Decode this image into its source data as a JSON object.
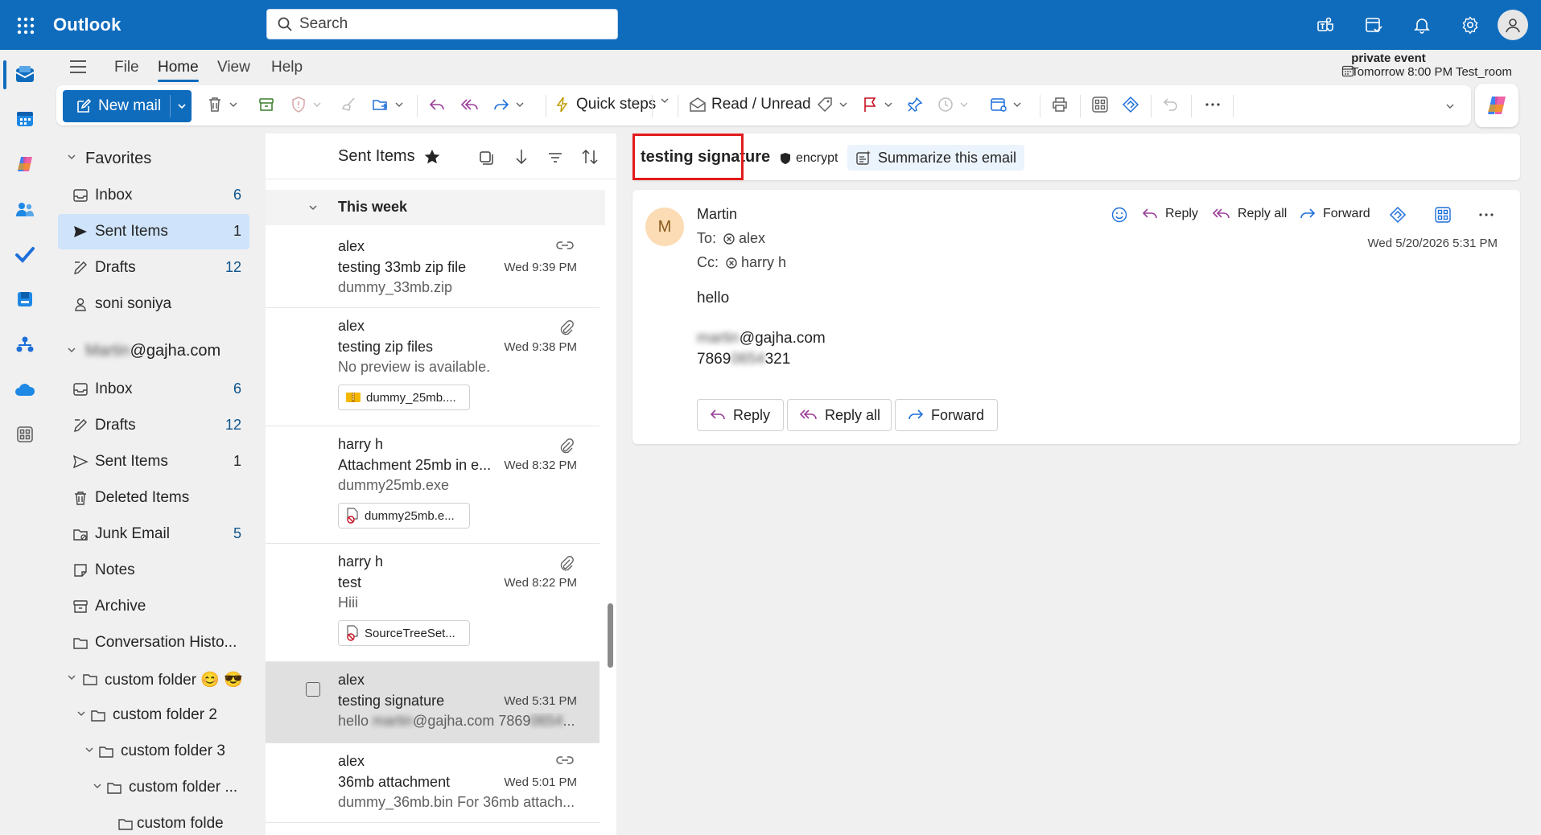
{
  "app": {
    "title": "Outlook"
  },
  "search": {
    "placeholder": "Search"
  },
  "menu": {
    "file": "File",
    "home": "Home",
    "view": "View",
    "help": "Help"
  },
  "event": {
    "title": "private event",
    "detail": "Tomorrow 8:00 PM Test_room"
  },
  "ribbon": {
    "new_mail": "New mail",
    "quick_steps": "Quick steps",
    "read_unread": "Read / Unread"
  },
  "folders": {
    "favorites_header": "Favorites",
    "favorites": [
      {
        "label": "Inbox",
        "count": "6"
      },
      {
        "label": "Sent Items",
        "count": "1"
      },
      {
        "label": "Drafts",
        "count": "12"
      },
      {
        "label": "soni soniya",
        "count": ""
      }
    ],
    "account_blurred": "Martin",
    "account_domain": "@gajha.com",
    "account": [
      {
        "label": "Inbox",
        "count": "6"
      },
      {
        "label": "Drafts",
        "count": "12"
      },
      {
        "label": "Sent Items",
        "count": "1"
      },
      {
        "label": "Deleted Items",
        "count": ""
      },
      {
        "label": "Junk Email",
        "count": "5"
      },
      {
        "label": "Notes",
        "count": ""
      },
      {
        "label": "Archive",
        "count": ""
      },
      {
        "label": "Conversation Histo...",
        "count": ""
      },
      {
        "label": "custom folder 😊 😎",
        "count": ""
      },
      {
        "label": "custom folder 2",
        "count": ""
      },
      {
        "label": "custom folder 3",
        "count": ""
      },
      {
        "label": "custom folder ...",
        "count": ""
      },
      {
        "label": "custom folde",
        "count": ""
      }
    ]
  },
  "list": {
    "title": "Sent Items",
    "group": "This week",
    "messages": [
      {
        "from": "alex",
        "subject": "testing 33mb zip file",
        "preview": "dummy_33mb.zip",
        "time": "Wed 9:39 PM",
        "icon": "link-icon",
        "chip": ""
      },
      {
        "from": "alex",
        "subject": "testing zip files",
        "preview": "No preview is available.",
        "time": "Wed 9:38 PM",
        "icon": "paperclip-icon",
        "chip": "dummy_25mb...."
      },
      {
        "from": "harry h",
        "subject": "Attachment 25mb in e...",
        "preview": "dummy25mb.exe",
        "time": "Wed 8:32 PM",
        "icon": "paperclip-icon",
        "chip": "dummy25mb.e..."
      },
      {
        "from": "harry h",
        "subject": "test",
        "preview": "Hiii",
        "time": "Wed 8:22 PM",
        "icon": "paperclip-icon",
        "chip": "SourceTreeSet..."
      },
      {
        "from": "alex",
        "subject": "testing signature",
        "preview_a": "hello ",
        "preview_blur": "martin",
        "preview_b": "@gajha.com 7869",
        "preview_blur2": "0654",
        "preview_c": "...",
        "time": "Wed 5:31 PM",
        "icon": "",
        "chip": ""
      },
      {
        "from": "alex",
        "subject": "36mb attachment",
        "preview": "dummy_36mb.bin For 36mb attach...",
        "time": "Wed 5:01 PM",
        "icon": "link-icon",
        "chip": ""
      }
    ]
  },
  "reading": {
    "subject": "testing signature",
    "encrypt": "encrypt",
    "summarize": "Summarize this email",
    "avatar": "M",
    "sender": "Martin",
    "to_label": "To:",
    "to": "alex",
    "cc_label": "Cc:",
    "cc": "harry h",
    "date": "Wed 5/20/2026 5:31 PM",
    "reply": "Reply",
    "reply_all": "Reply all",
    "forward": "Forward",
    "body_line1": "hello",
    "sig_blur": "martin",
    "sig_email": "@gajha.com",
    "sig_phone_a": "7869",
    "sig_phone_blur": "0654",
    "sig_phone_b": "321"
  },
  "colors": {
    "brand": "#0f6cbd",
    "selected": "#cfe4fa",
    "highlight": "#e21b1b"
  }
}
